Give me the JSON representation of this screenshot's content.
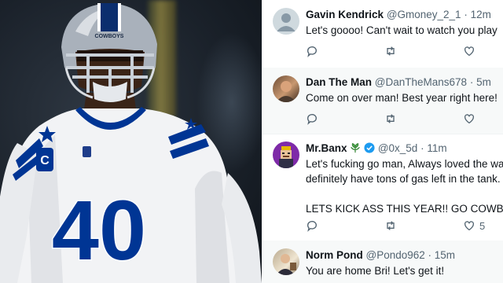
{
  "photo": {
    "jersey_number": "40",
    "captain_patch": "C",
    "helmet_text": "COWBOYS"
  },
  "tweets": [
    {
      "name": "Gavin Kendrick",
      "handle": "@Gmoney_2_1",
      "time": "· 12m",
      "text": [
        "Let's goooo! Can't wait to watch you play"
      ],
      "like_count": "",
      "avatar": "default-avatar"
    },
    {
      "name": "Dan The Man",
      "handle": "@DanTheMans678",
      "time": "· 5m",
      "text": [
        "Come on over man! Best year right here!"
      ],
      "like_count": "",
      "avatar": "photo-avatar"
    },
    {
      "name": "Mr.Banx",
      "handle": "@0x_5d",
      "time": "· 11m",
      "text": [
        "Let's fucking go man, Always loved the way",
        "definitely have tons of gas left in the tank.",
        "",
        "LETS KICK ASS THIS YEAR!! GO COWBOYS"
      ],
      "like_count": "5",
      "verified": true,
      "avatar": "cartoon-avatar"
    },
    {
      "name": "Norm Pond",
      "handle": "@Pondo962",
      "time": "· 15m",
      "text": [
        "You are home Bri! Let's get it!"
      ],
      "like_count": "",
      "avatar": "photo-avatar"
    }
  ],
  "colors": {
    "jersey_white": "#f3f4f6",
    "jersey_blue": "#003594",
    "verified_blue": "#1d9bf0",
    "muted_text": "#536471",
    "primary_text": "#0f1419",
    "divider": "#eff3f4"
  }
}
